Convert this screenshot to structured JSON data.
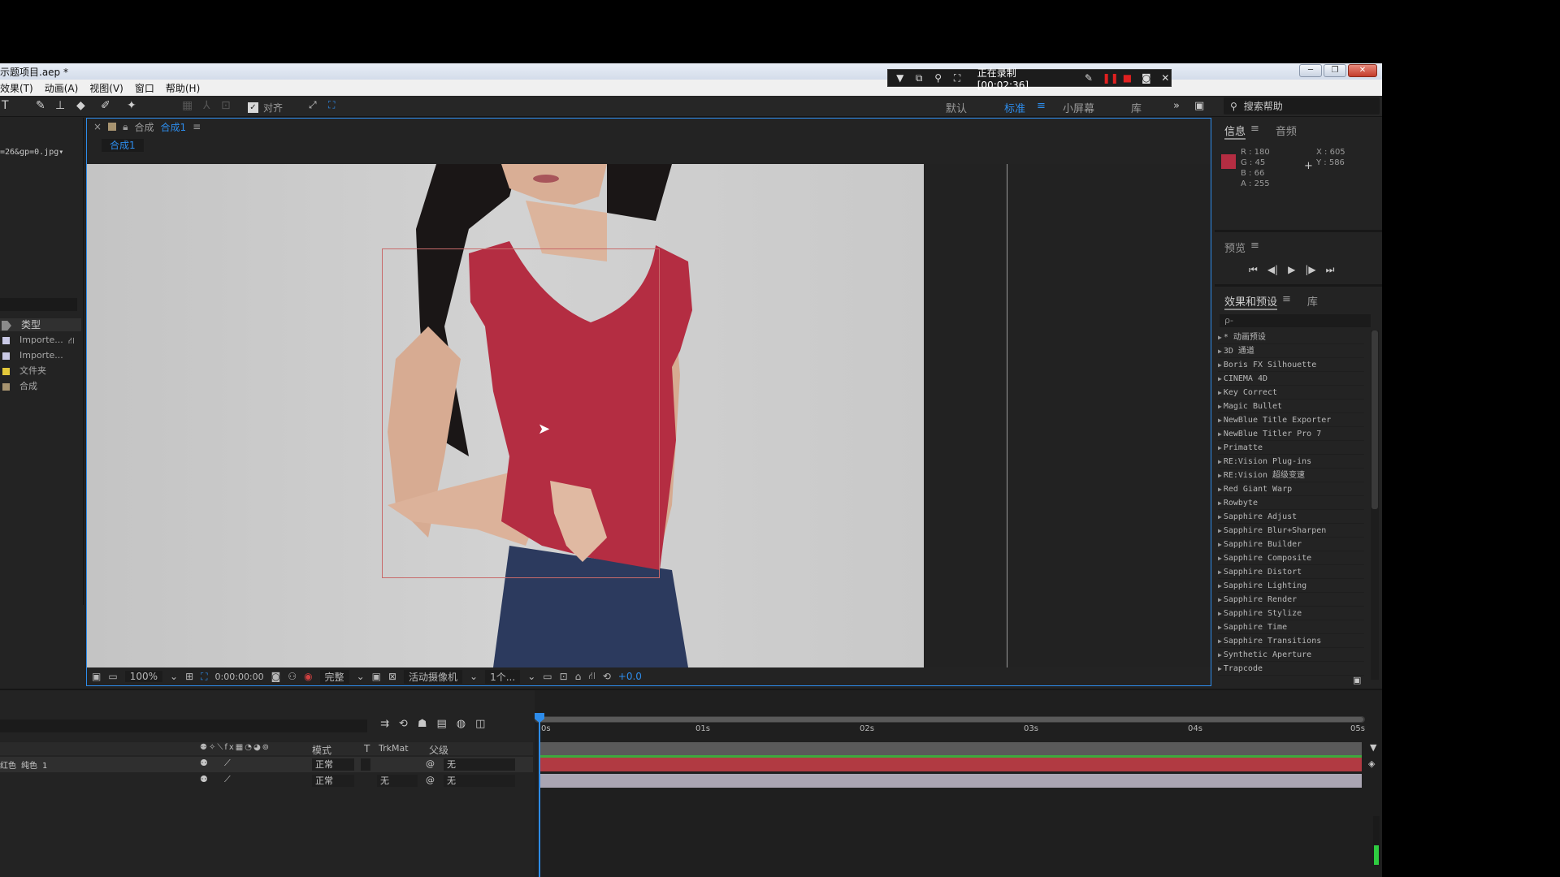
{
  "window": {
    "title": "示题项目.aep *",
    "controls": [
      "minimize-icon",
      "maximize-icon",
      "close-icon"
    ]
  },
  "recording_bar": {
    "status": "正在录制 [00:02:36]",
    "icons": [
      "dropdown-icon",
      "window-icon",
      "zoom-icon",
      "fullscreen-icon",
      "pen-icon",
      "pause-icon",
      "stop-icon",
      "camera-icon",
      "close-icon"
    ]
  },
  "menubar": {
    "items": [
      "效果(T)",
      "动画(A)",
      "视图(V)",
      "窗口",
      "帮助(H)"
    ]
  },
  "toolbar": {
    "snap_label": "对齐",
    "workspaces": [
      "默认",
      "标准",
      "小屏幕",
      "库"
    ],
    "active_workspace": "标准",
    "more": "»",
    "search_placeholder": "搜索帮助"
  },
  "project_panel": {
    "selected_file": "=26&gp=0.jpg▾",
    "column_header": "类型",
    "items": [
      {
        "label": "Importe...",
        "color": "#c9c9e6"
      },
      {
        "label": "Importe...",
        "color": "#c9c9e6"
      },
      {
        "label": "文件夹",
        "color": "#e3c83a"
      },
      {
        "label": "合成",
        "color": "#a89470"
      }
    ]
  },
  "composition_panel": {
    "tab_prefix": "合成",
    "tab_name": "合成1",
    "sub_tab": "合成1",
    "footer": {
      "zoom": "100%",
      "timecode": "0:00:00:00",
      "resolution": "完整",
      "camera": "活动摄像机",
      "views": "1个...",
      "exposure": "+0.0"
    }
  },
  "info_panel": {
    "tabs": [
      "信息",
      "音频"
    ],
    "active_tab": "信息",
    "r": "R : 180",
    "g": "G : 45",
    "b": "B : 66",
    "a": "A : 255",
    "x": "X : 605",
    "y": "Y : 586",
    "swatch_color": "#b42d42"
  },
  "preview_panel": {
    "title": "预览",
    "controls": [
      "first-frame-icon",
      "prev-frame-icon",
      "play-icon",
      "next-frame-icon",
      "last-frame-icon"
    ]
  },
  "effects_panel": {
    "tabs": [
      "效果和预设",
      "库"
    ],
    "active_tab": "效果和预设",
    "search_placeholder": "ρ-",
    "items": [
      "* 动画预设",
      "3D 通道",
      "Boris FX Silhouette",
      "CINEMA 4D",
      "Key Correct",
      "Magic Bullet",
      "NewBlue Title Exporter",
      "NewBlue Titler Pro 7",
      "Primatte",
      "RE:Vision Plug-ins",
      "RE:Vision 超级变速",
      "Red Giant Warp",
      "Rowbyte",
      "Sapphire Adjust",
      "Sapphire Blur+Sharpen",
      "Sapphire Builder",
      "Sapphire Composite",
      "Sapphire Distort",
      "Sapphire Lighting",
      "Sapphire Render",
      "Sapphire Stylize",
      "Sapphire Time",
      "Sapphire Transitions",
      "Synthetic Aperture",
      "Trapcode"
    ]
  },
  "timeline": {
    "columns": {
      "mode": "模式",
      "t": "T",
      "trkmat": "TrkMat",
      "parent": "父级"
    },
    "ruler": [
      "0s",
      "01s",
      "02s",
      "03s",
      "04s",
      "05s"
    ],
    "layers": [
      {
        "name": "红色 纯色 1",
        "mode": "正常",
        "trkmat": "",
        "parent": "无",
        "bar_color": "#b13a42"
      },
      {
        "name": "",
        "mode": "正常",
        "trkmat": "无",
        "parent": "无",
        "bar_color": "#aaa5b2"
      }
    ],
    "work_area_color": "#5a5a5a",
    "audio_level": 0.4
  },
  "colors": {
    "accent": "#2d8ceb",
    "panel_bg": "#232323",
    "shirt_red": "#b42d42"
  }
}
